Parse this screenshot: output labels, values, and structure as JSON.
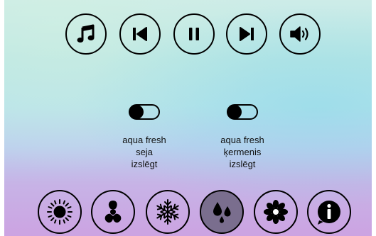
{
  "toolbar": {
    "buttons": [
      {
        "icon": "music-note-icon"
      },
      {
        "icon": "previous-icon"
      },
      {
        "icon": "pause-icon"
      },
      {
        "icon": "next-icon"
      },
      {
        "icon": "volume-icon"
      }
    ]
  },
  "toggles": [
    {
      "line1": "aqua fresh",
      "line2": "seja",
      "line3": "izslēgt",
      "state": "off"
    },
    {
      "line1": "aqua fresh",
      "line2": "ķermenis",
      "line3": "izslēgt",
      "state": "off"
    }
  ],
  "modes": [
    {
      "icon": "sun-icon",
      "active": false
    },
    {
      "icon": "fan-icon",
      "active": false
    },
    {
      "icon": "snowflake-icon",
      "active": false
    },
    {
      "icon": "water-drops-icon",
      "active": true
    },
    {
      "icon": "flower-icon",
      "active": false
    },
    {
      "icon": "info-icon",
      "active": false
    }
  ],
  "colors": {
    "active_button": "#7a6e8e",
    "stroke": "#000000"
  }
}
